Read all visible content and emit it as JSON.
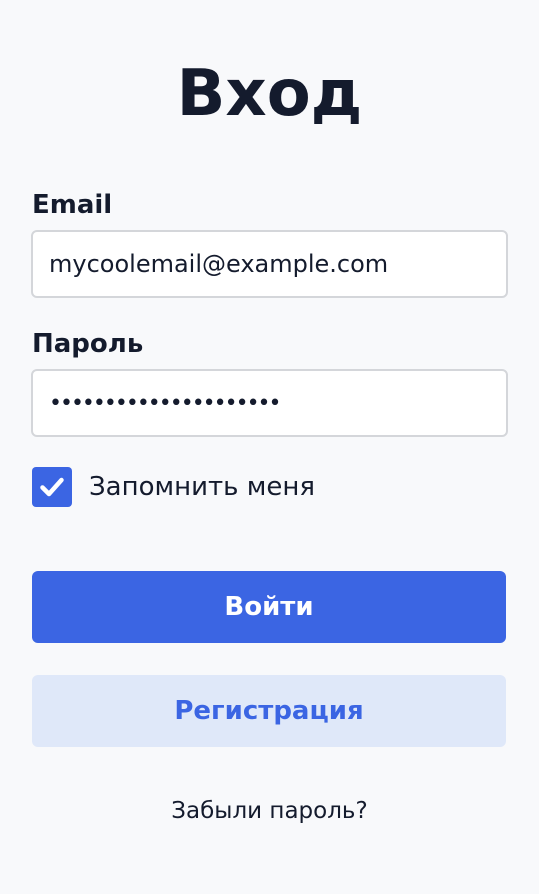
{
  "page": {
    "title": "Вход"
  },
  "form": {
    "email": {
      "label": "Email",
      "value": "mycoolemail@example.com"
    },
    "password": {
      "label": "Пароль",
      "value": "•••••••••••••••••••••"
    },
    "remember": {
      "label": "Запомнить меня",
      "checked": true,
      "icon": "check-icon"
    },
    "login_button": "Войти",
    "register_button": "Регистрация",
    "forgot_password": "Забыли пароль?"
  },
  "colors": {
    "background": "#f8f9fb",
    "primary": "#3b65e3",
    "secondary_bg": "#dfe8f9",
    "text": "#141b2d",
    "border": "#d4d6da"
  }
}
